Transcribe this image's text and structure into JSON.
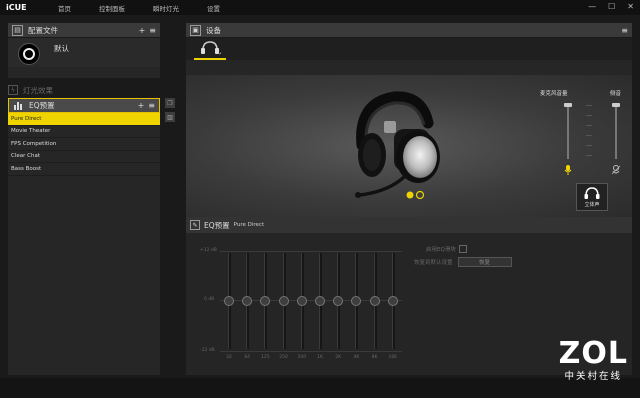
{
  "app": {
    "brand": "iCUE"
  },
  "nav": {
    "items": [
      "首页",
      "控制面板",
      "瞬时灯光",
      "设置"
    ]
  },
  "window": {
    "minimize": "—",
    "maximize": "☐",
    "close": "✕"
  },
  "profiles": {
    "title": "配置文件",
    "add": "+",
    "menu": "≡",
    "current": "默认"
  },
  "lighting": {
    "label": "灯光效果"
  },
  "eq_presets": {
    "title": "EQ预置",
    "add": "+",
    "menu": "≡",
    "items": [
      "Pure Direct",
      "Movie Theater",
      "FPS Competition",
      "Clear Chat",
      "Bass Boost"
    ],
    "selected_index": 0
  },
  "devices": {
    "title": "设备",
    "menu": "≡"
  },
  "stage": {
    "mic_volume_label": "麦克风音量",
    "sidetone_label": "侧音",
    "surround_label": "立体声",
    "mic_level": 0.0,
    "sidetone_level": 0.0
  },
  "eq": {
    "title": "EQ预置",
    "preset": "Pure Direct",
    "db_labels": [
      "+12 dB",
      "0 dB",
      "-12 dB"
    ],
    "bands": [
      {
        "freq": "32",
        "gain": 0
      },
      {
        "freq": "64",
        "gain": 0
      },
      {
        "freq": "125",
        "gain": 0
      },
      {
        "freq": "250",
        "gain": 0
      },
      {
        "freq": "500",
        "gain": 0
      },
      {
        "freq": "1K",
        "gain": 0
      },
      {
        "freq": "2K",
        "gain": 0
      },
      {
        "freq": "4K",
        "gain": 0
      },
      {
        "freq": "8K",
        "gain": 0
      },
      {
        "freq": "16K",
        "gain": 0
      }
    ],
    "auto_label": "启用EQ滑块",
    "reset_label": "恢复到默认设置",
    "reset_button": "恢复"
  },
  "watermark": {
    "logo": "ZOL",
    "tagline": "中关村在线"
  },
  "colors": {
    "accent": "#f0d400",
    "panel": "#262626",
    "header": "#3a3a3a"
  }
}
